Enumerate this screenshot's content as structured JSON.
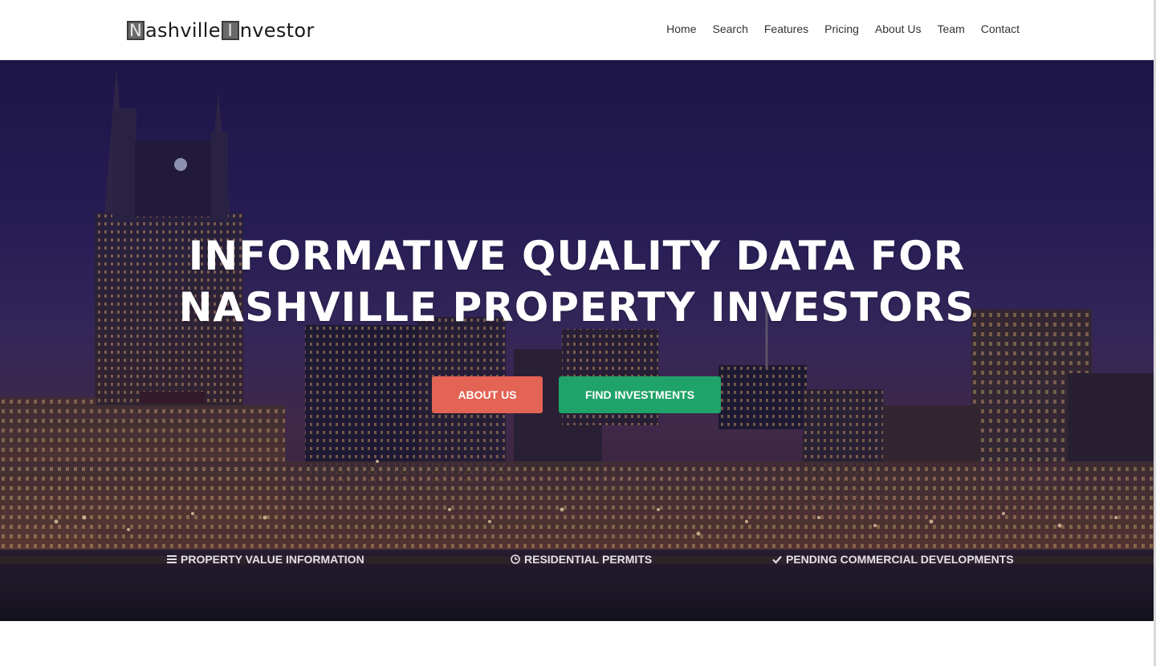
{
  "brand": {
    "initial1": "N",
    "word1": "ashville",
    "initial2": "I",
    "word2": "nvestor"
  },
  "nav": {
    "items": [
      "Home",
      "Search",
      "Features",
      "Pricing",
      "About Us",
      "Team",
      "Contact"
    ]
  },
  "hero": {
    "headline_line1": "INFORMATIVE QUALITY DATA FOR",
    "headline_line2": "NASHVILLE PROPERTY INVESTORS",
    "about_button": "ABOUT US",
    "find_button": "FIND INVESTMENTS"
  },
  "features": [
    {
      "icon": "list-icon",
      "label": "PROPERTY VALUE INFORMATION"
    },
    {
      "icon": "clock-icon",
      "label": "RESIDENTIAL PERMITS"
    },
    {
      "icon": "check-icon",
      "label": "PENDING COMMERCIAL DEVELOPMENTS"
    }
  ],
  "colors": {
    "about_button": "#e36355",
    "find_button": "#1fa36a",
    "hero_sky": "#1f174e"
  }
}
